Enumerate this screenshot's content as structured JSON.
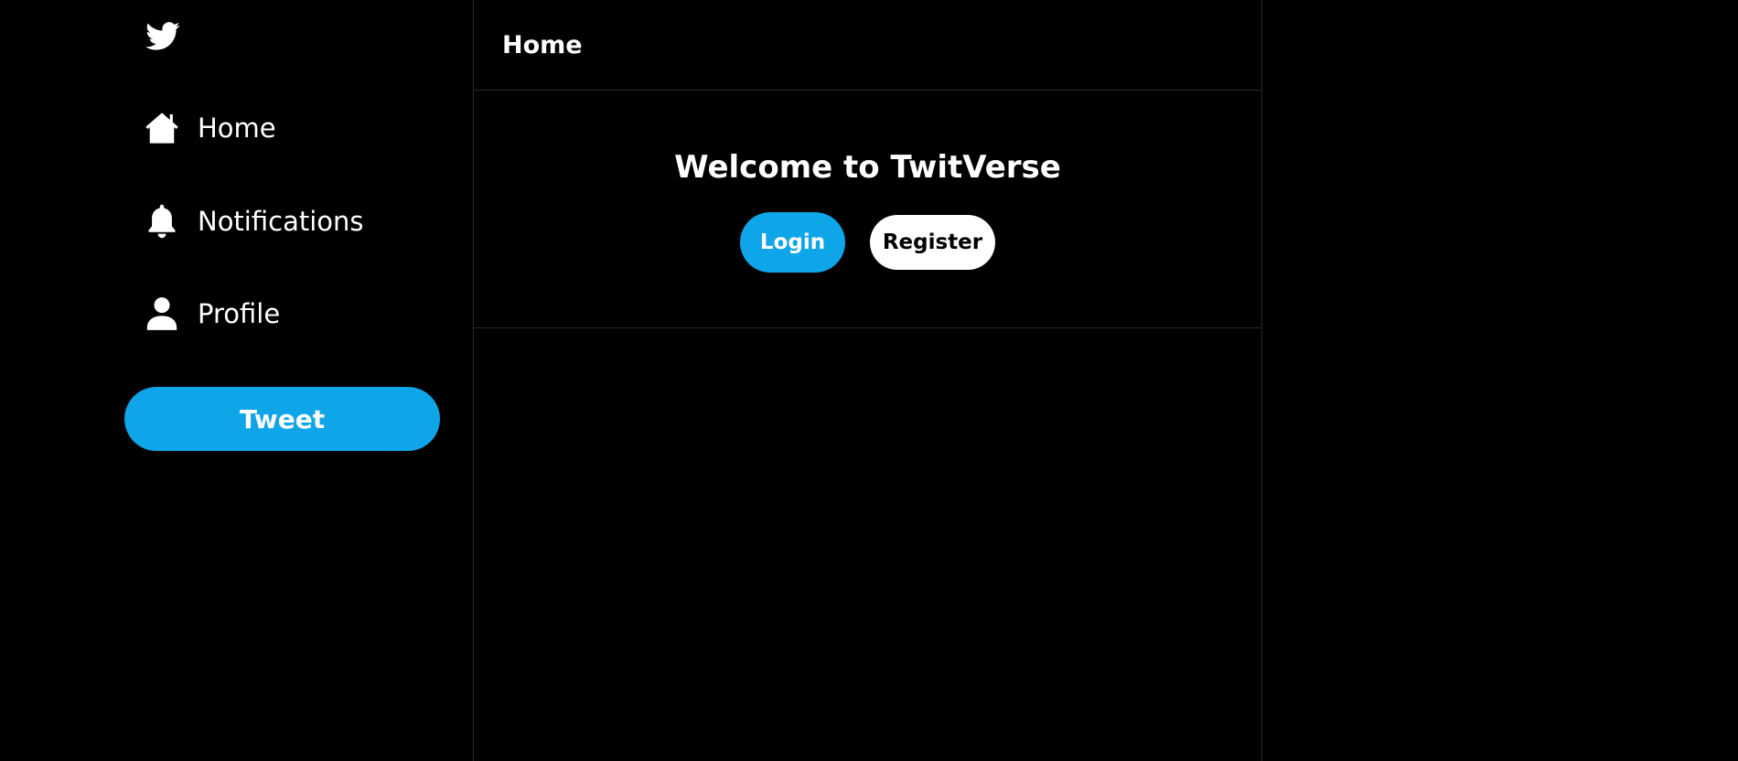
{
  "sidebar": {
    "logo_icon": "twitter-bird-icon",
    "items": [
      {
        "label": "Home",
        "icon": "home-icon"
      },
      {
        "label": "Notifications",
        "icon": "bell-icon"
      },
      {
        "label": "Profile",
        "icon": "user-icon"
      }
    ],
    "tweet_label": "Tweet"
  },
  "main": {
    "header_title": "Home",
    "welcome": {
      "title": "Welcome to TwitVerse",
      "login_label": "Login",
      "register_label": "Register"
    }
  },
  "colors": {
    "background": "#000000",
    "accent": "#0ea5e9",
    "text": "#ffffff",
    "divider": "#2a2a2a"
  }
}
